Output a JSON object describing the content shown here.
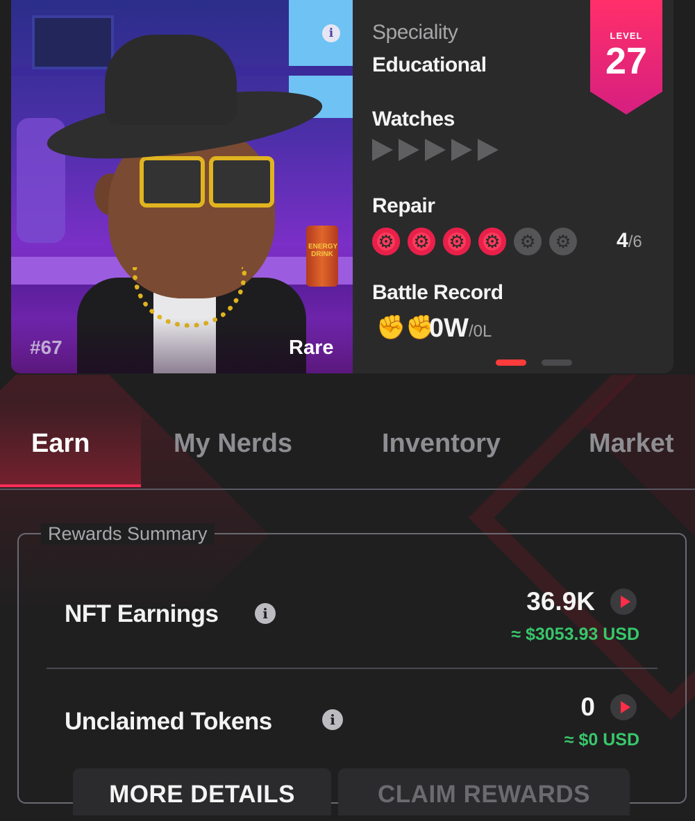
{
  "card": {
    "nft_id": "#67",
    "rarity": "Rare",
    "can_text": "ENERGY DRINK",
    "speciality_label": "Speciality",
    "speciality_value": "Educational",
    "watches_label": "Watches",
    "watches_filled": 0,
    "watches_total": 5,
    "repair_label": "Repair",
    "repair_current": "4",
    "repair_total": "/6",
    "battle_label": "Battle Record",
    "battle_wins": "0W",
    "battle_losses": "/0L",
    "level_label": "LEVEL",
    "level_value": "27",
    "carousel_active": 1,
    "carousel_total": 2
  },
  "tabs": [
    {
      "label": "Earn",
      "active": true
    },
    {
      "label": "My Nerds",
      "active": false
    },
    {
      "label": "Inventory",
      "active": false
    },
    {
      "label": "Market",
      "active": false
    }
  ],
  "rewards": {
    "title": "Rewards Summary",
    "nft_earnings": {
      "label": "NFT Earnings",
      "value": "36.9K",
      "usd": "≈ $3053.93 USD"
    },
    "unclaimed_tokens": {
      "label": "Unclaimed Tokens",
      "value": "0",
      "usd": "≈ $0 USD"
    }
  },
  "buttons": {
    "more_details": "MORE DETAILS",
    "claim_rewards": "CLAIM REWARDS"
  },
  "colors": {
    "accent": "#ff2d55",
    "level_badge": "#e8206f",
    "usd_green": "#38c76a",
    "background": "#1f1f20"
  },
  "icons": {
    "info": "info-icon",
    "repair": "wrench-gear-icon",
    "battle": "boxing-gloves-icon",
    "play": "play-icon"
  }
}
